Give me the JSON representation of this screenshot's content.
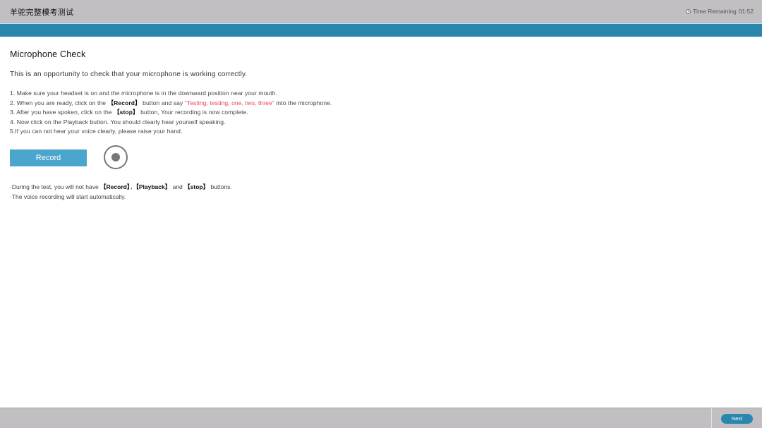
{
  "header": {
    "title": "羊驼完整模考测试",
    "timer_label": "Time Remaining",
    "timer_value": "01:52"
  },
  "main": {
    "heading": "Microphone Check",
    "intro": "This is an opportunity to check that your microphone is working correctly.",
    "steps": {
      "s1": "1. Make sure your headset is on and the microphone is in the downward position near your mouth.",
      "s2_a": "2. When you are ready, click on the ",
      "s2_bold": "【Record】",
      "s2_b": " button and say ",
      "s2_red": "\"Testing, testing, one, two, three\"",
      "s2_c": " into the microphone.",
      "s3_a": "3. After you have spoken, click on the ",
      "s3_bold": "【stop】",
      "s3_b": " button, Your recording is now complete.",
      "s4": "4. Now click on the Playback button. You should clearly hear yourself speaking.",
      "s5": "5.If you can not hear your voice clearly, please raise your hand."
    },
    "record_button": "Record",
    "notes": {
      "n1_a": "·During the test, you will not have ",
      "n1_b1": "【Record】",
      "n1_sep": "，",
      "n1_b2": "【Playback】",
      "n1_and": " and ",
      "n1_b3": "【stop】",
      "n1_end": " buttons.",
      "n2": "·The voice recording will start automatically."
    }
  },
  "footer": {
    "next_label": "Next"
  },
  "colors": {
    "accent": "#2b86ad",
    "record_button": "#4aa6cc",
    "highlight_red": "#e8424a",
    "bar_gray": "#c2bfc2"
  }
}
